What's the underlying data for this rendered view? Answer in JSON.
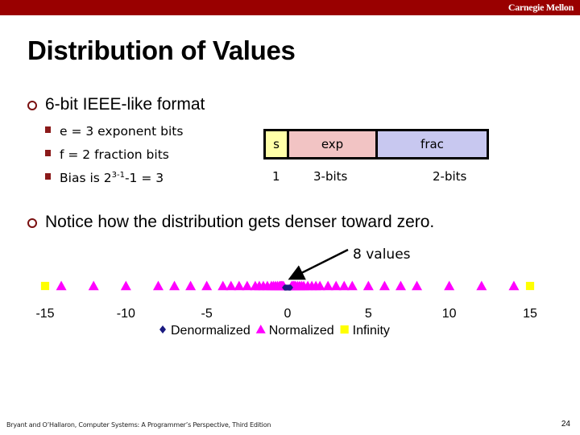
{
  "header": {
    "brand": "Carnegie Mellon",
    "bar_color": "#990000"
  },
  "slide": {
    "title": "Distribution of Values",
    "bullets": [
      {
        "text": "6-bit IEEE-like format",
        "subbullets": [
          {
            "text": "e = 3 exponent bits"
          },
          {
            "text": "f = 2 fraction bits"
          },
          {
            "pre": "Bias is 2",
            "sup": "3-1",
            "post": "-1 = 3"
          }
        ]
      },
      {
        "text": "Notice how the distribution gets denser toward zero."
      }
    ],
    "format_diagram": {
      "fields": [
        {
          "label": "s",
          "bits": "1",
          "color": "#ffffa8"
        },
        {
          "label": "exp",
          "bits": "3-bits",
          "color": "#f2c4c4"
        },
        {
          "label": "frac",
          "bits": "2-bits",
          "color": "#c8c8f0"
        }
      ]
    }
  },
  "chart_data": {
    "type": "scatter",
    "title": "",
    "xlabel": "",
    "ylabel": "",
    "xlim": [
      -15,
      15
    ],
    "xticks": [
      -15,
      -10,
      -5,
      0,
      5,
      10,
      15
    ],
    "xtick_labels": [
      "-15",
      "-10",
      "-5",
      "0",
      "5",
      "10",
      "15"
    ],
    "grid": false,
    "legend_position": "bottom",
    "annotation": {
      "text": "8 values",
      "points_to": 0
    },
    "series": [
      {
        "name": "Denormalized",
        "marker": "diamond",
        "color": "#1a1a80",
        "values": [
          -0.1875,
          -0.125,
          -0.0625,
          0,
          0.0625,
          0.125,
          0.1875
        ]
      },
      {
        "name": "Normalized",
        "marker": "triangle",
        "color": "#ff00ff",
        "values": [
          -14,
          -12,
          -10,
          -8,
          -7,
          -6,
          -5,
          -4,
          -3.5,
          -3,
          -2.5,
          -2,
          -1.75,
          -1.5,
          -1.25,
          -1,
          -0.875,
          -0.75,
          -0.625,
          -0.5,
          -0.4375,
          -0.375,
          -0.3125,
          -0.25,
          0.25,
          0.3125,
          0.375,
          0.4375,
          0.5,
          0.625,
          0.75,
          0.875,
          1,
          1.25,
          1.5,
          1.75,
          2,
          2.5,
          3,
          3.5,
          4,
          5,
          6,
          7,
          8,
          10,
          12,
          14
        ]
      },
      {
        "name": "Infinity",
        "marker": "square",
        "color": "#ffff00",
        "values": [
          -15,
          15
        ]
      }
    ]
  },
  "footer": {
    "citation": "Bryant and O’Hallaron, Computer Systems: A Programmer’s Perspective, Third Edition",
    "page": "24"
  }
}
